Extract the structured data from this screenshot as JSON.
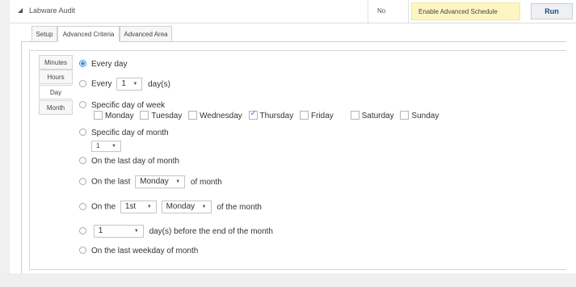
{
  "header": {
    "expander_icon": "triangle-down-icon",
    "title": "Labware Audit",
    "no_value": "No",
    "schedule_label": "Enable Advanced Schedule",
    "run_label": "Run"
  },
  "tabs": [
    {
      "label": "Setup",
      "active": false
    },
    {
      "label": "Advanced Criteria",
      "active": true
    },
    {
      "label": "Advanced Area",
      "active": false
    }
  ],
  "frequency_tabs": [
    {
      "label": "Minutes",
      "active": false
    },
    {
      "label": "Hours",
      "active": false
    },
    {
      "label": "Day",
      "active": true
    },
    {
      "label": "Month",
      "active": false
    }
  ],
  "options": {
    "every_day": "Every day",
    "every_prefix": "Every",
    "every_value": "1",
    "every_suffix": "day(s)",
    "specific_week": "Specific day of week",
    "weekdays": [
      {
        "label": "Monday",
        "checked": false
      },
      {
        "label": "Tuesday",
        "checked": false
      },
      {
        "label": "Wednesday",
        "checked": false
      },
      {
        "label": "Thursday",
        "checked": true
      },
      {
        "label": "Friday",
        "checked": false
      },
      {
        "label": "Saturday",
        "checked": false
      },
      {
        "label": "Sunday",
        "checked": false
      }
    ],
    "specific_month": "Specific day of month",
    "month_day_value": "1",
    "last_day": "On the last day of month",
    "last_prefix": "On the last",
    "last_weekday_value": "Monday",
    "last_suffix": "of month",
    "nth_prefix": "On the",
    "nth_value": "1st",
    "nth_weekday_value": "Monday",
    "nth_suffix": "of the month",
    "before_end_value": "1",
    "before_end_suffix": "day(s) before the end of the month",
    "last_weekday": "On the last weekday of month"
  },
  "colors": {
    "accent": "#4a90d9",
    "highlight": "#fdf6c3"
  }
}
